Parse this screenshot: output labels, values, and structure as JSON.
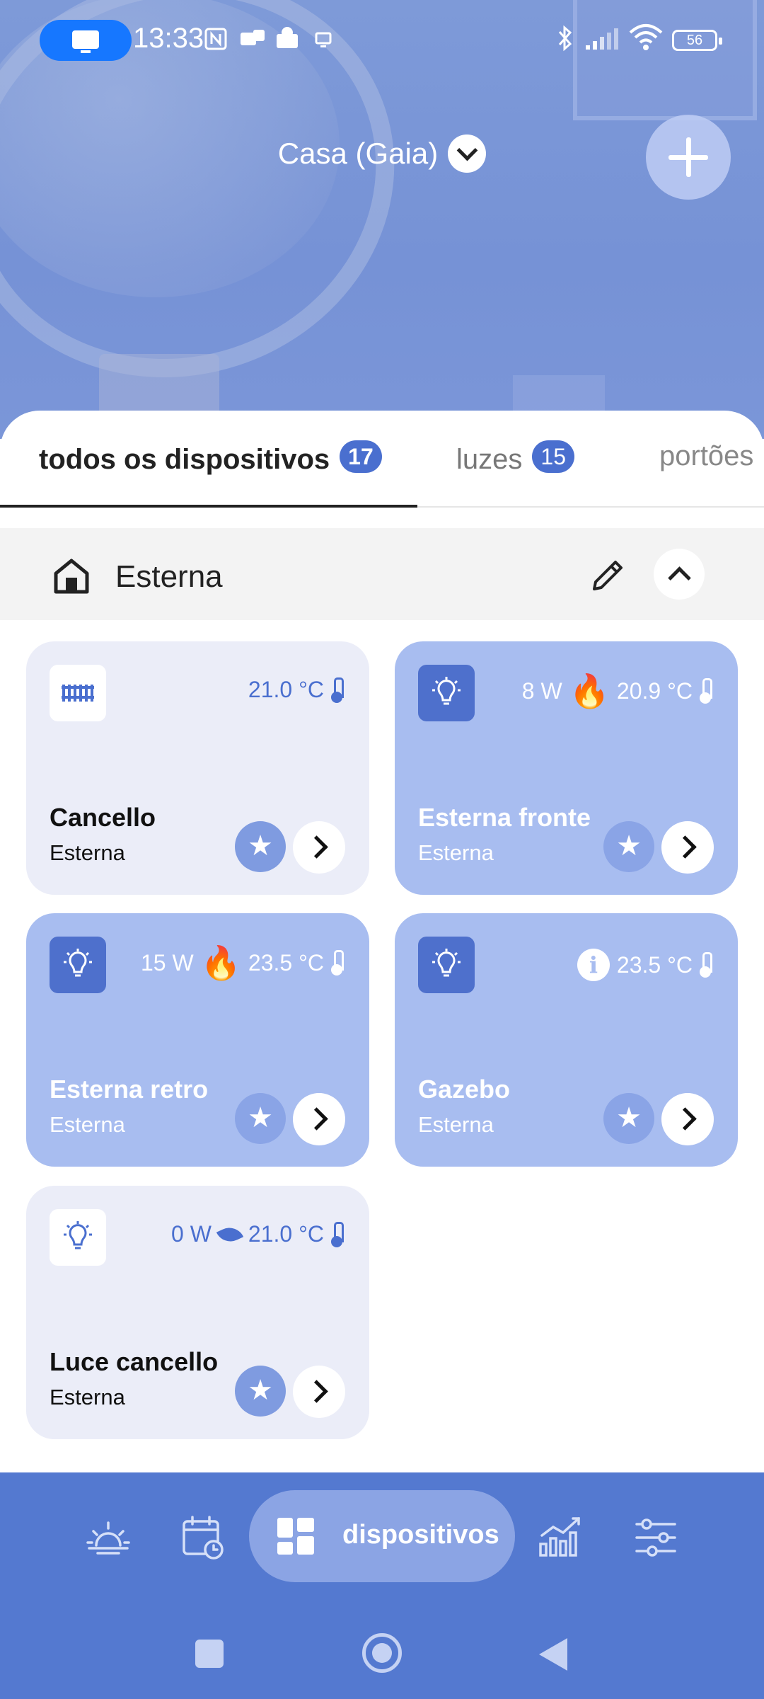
{
  "status_bar": {
    "time": "13:33",
    "battery": "56"
  },
  "header": {
    "home_name": "Casa (Gaia)"
  },
  "tabs": [
    {
      "label": "todos os dispositivos",
      "count": "17"
    },
    {
      "label": "luzes",
      "count": "15"
    },
    {
      "label": "portões",
      "count": ""
    }
  ],
  "group": {
    "name": "Esterna"
  },
  "devices": [
    {
      "name": "Cancello",
      "room": "Esterna",
      "power": "",
      "temperature": "21.0 °C",
      "icon": "gate-icon"
    },
    {
      "name": "Esterna fronte",
      "room": "Esterna",
      "power": "8 W",
      "temperature": "20.9 °C",
      "icon": "bulb-icon",
      "status_icon": "flame-icon"
    },
    {
      "name": "Esterna retro",
      "room": "Esterna",
      "power": "15 W",
      "temperature": "23.5 °C",
      "icon": "bulb-icon",
      "status_icon": "flame-icon"
    },
    {
      "name": "Gazebo",
      "room": "Esterna",
      "power": "",
      "temperature": "23.5 °C",
      "icon": "bulb-icon",
      "status_icon": "info-icon",
      "info_glyph": "i"
    },
    {
      "name": "Luce cancello",
      "room": "Esterna",
      "power": "0 W",
      "temperature": "21.0 °C",
      "icon": "bulb-icon",
      "status_icon": "leaf-icon"
    }
  ],
  "bottom_nav": {
    "active_label": "dispositivos",
    "items": [
      "scenes-icon",
      "schedule-icon",
      "devices-icon",
      "stats-icon",
      "settings-icon"
    ]
  },
  "colors": {
    "accent": "#4a6fcf",
    "nav": "#5479d0",
    "card_active": "#a8bdf0",
    "card_idle": "#ebedf8"
  }
}
